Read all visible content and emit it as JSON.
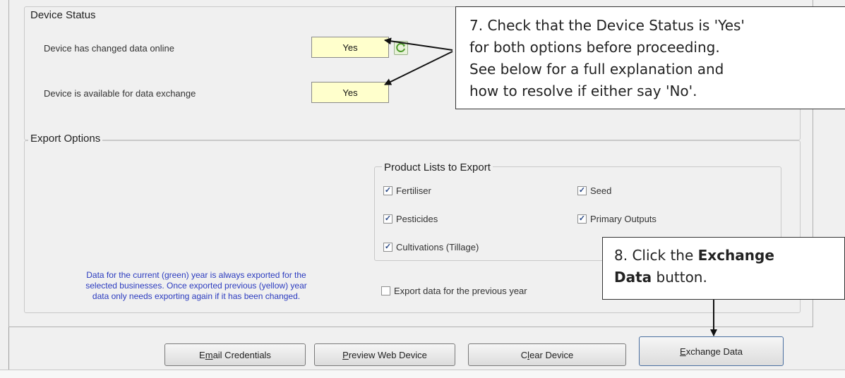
{
  "device_status": {
    "title": "Device Status",
    "changed_label": "Device has changed data online",
    "changed_value": "Yes",
    "available_label": "Device is available for data exchange",
    "available_value": "Yes"
  },
  "export_options": {
    "title": "Export Options",
    "product_lists_title": "Product Lists to Export",
    "items": [
      {
        "label": "Fertiliser",
        "checked": true
      },
      {
        "label": "Seed",
        "checked": true
      },
      {
        "label": "Pesticides",
        "checked": true
      },
      {
        "label": "Primary Outputs",
        "checked": true
      },
      {
        "label": "Cultivations (Tillage)",
        "checked": true
      }
    ],
    "note_lines": [
      "Data for the current (green) year is always exported for the",
      "selected businesses. Once exported previous (yellow) year",
      "data only needs exporting again if it has been changed."
    ],
    "previous_year": {
      "label": "Export data for the previous year",
      "checked": false
    }
  },
  "buttons": {
    "email_mn": "m",
    "email_pre": "E",
    "email_post": "ail Credentials",
    "preview_mn": "P",
    "preview_post": "review Web Device",
    "clear_pre": "C",
    "clear_mn": "l",
    "clear_post": "ear Device",
    "exchange_mn": "E",
    "exchange_post": "xchange Data"
  },
  "callouts": {
    "step7_lines": [
      "7. Check that the Device Status is 'Yes'",
      "for both options before proceeding.",
      "See below for a full explanation and",
      "how to resolve if either say 'No'."
    ],
    "step8_line1_pre": "8. Click the ",
    "step8_line1_bold": "Exchange",
    "step8_line2_bold": "Data",
    "step8_line2_post": " button."
  },
  "colors": {
    "field_yellow": "#ffffcc",
    "note_blue": "#2b3bbf"
  }
}
